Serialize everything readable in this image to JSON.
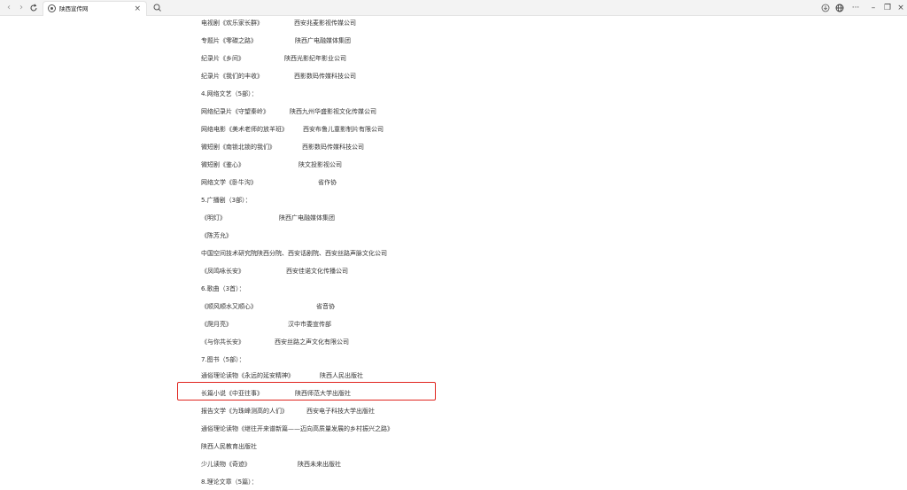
{
  "browser": {
    "back_icon": "back-arrow-icon",
    "forward_icon": "forward-arrow-icon",
    "refresh_icon": "refresh-icon",
    "tab_title": "陕西宣传网",
    "tab_close": "×",
    "search_icon": "search-icon",
    "window_controls": {
      "download_icon": "download-icon",
      "globe_icon": "globe-icon",
      "more": "···",
      "minimize": "–",
      "restore": "❐",
      "close": "×"
    }
  },
  "lines": [
    {
      "text": "电视剧《欢乐家长群》",
      "org": "西安兆麦影视传媒公司"
    },
    {
      "text": "专题片《零碳之路》",
      "org": "陕西广电融媒体集团"
    },
    {
      "text": "纪录片《乡间》",
      "org": "陕西光影纪年影业公司"
    },
    {
      "text": "纪录片《我们的丰收》",
      "org": "西影数码传媒科技公司"
    },
    {
      "text": "4.网络文艺（5部）：",
      "org": ""
    },
    {
      "text": "网络纪录片《守望秦岭》",
      "org": "陕西九州华盛影视文化传媒公司"
    },
    {
      "text": "网络电影《美术老师的放羊班》",
      "org": "西安布鲁儿童影制片有限公司"
    },
    {
      "text": "微短剧《南锁北锁的我们》",
      "org": "西影数码传媒科技公司"
    },
    {
      "text": "微短剧《鉴心》",
      "org": "陕文投影视公司"
    },
    {
      "text": "网络文学《卧牛沟》",
      "org": "省作协"
    },
    {
      "text": "5.广播剧（3部）：",
      "org": ""
    },
    {
      "text": "《明灯》",
      "org": "陕西广电融媒体集团"
    },
    {
      "text": "《陈芳允》",
      "org": ""
    },
    {
      "text": "中国空间技术研究院陕西分院、西安话剧院、西安丝路声脉文化公司",
      "org": ""
    },
    {
      "text": "《凤鸣咏长安》",
      "org": "西安佳诺文化传播公司"
    },
    {
      "text": "6.歌曲（3首）：",
      "org": ""
    },
    {
      "text": "《顺风顺水又顺心》",
      "org": "省音协"
    },
    {
      "text": "《爬月亮》",
      "org": "汉中市委宣传部"
    },
    {
      "text": "《与你共长安》",
      "org": "西安丝路之声文化有限公司"
    },
    {
      "text": "7.图书（5部）：",
      "org": ""
    },
    {
      "text": "通俗理论读物《永远的延安精神》",
      "org": "陕西人民出版社"
    },
    {
      "text": "长篇小说《中亚往事》",
      "org": "陕西师范大学出版社"
    },
    {
      "text": "报告文学《为珠峰测高的人们》",
      "org": "西安电子科技大学出版社"
    },
    {
      "text": "通俗理论读物《继往开来谱新篇——迈向高质量发展的乡村振兴之路》",
      "org": ""
    },
    {
      "text": "陕西人民教育出版社",
      "org": ""
    },
    {
      "text": "少儿读物《奇迹》",
      "org": "陕西未来出版社"
    },
    {
      "text": "8.理论文章（5篇）：",
      "org": ""
    }
  ]
}
